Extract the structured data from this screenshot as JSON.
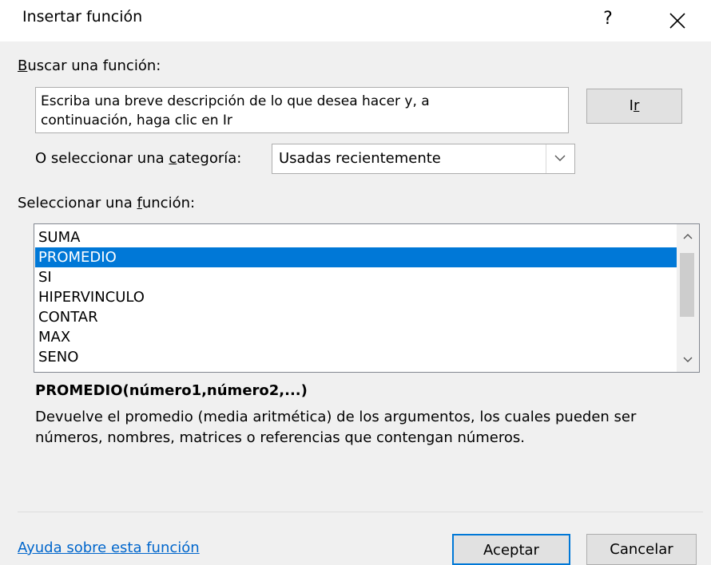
{
  "dialog": {
    "title": "Insertar función",
    "help_glyph": "?"
  },
  "search": {
    "label": "Buscar una función:",
    "label_prefix": "B",
    "label_rest": "uscar una función:",
    "value": "Escriba una breve descripción de lo que desea hacer y, a\ncontinuación, haga clic en Ir",
    "go_label_prefix": "I",
    "go_label_accel": "r",
    "go_label": "Ir"
  },
  "category": {
    "label_prefix": "O seleccionar una ",
    "label_accel": "c",
    "label_rest": "ategoría:",
    "selected": "Usadas recientemente"
  },
  "functions": {
    "label_prefix": "Seleccionar una ",
    "label_accel": "f",
    "label_rest": "unción:",
    "items": [
      "SUMA",
      "PROMEDIO",
      "SI",
      "HIPERVINCULO",
      "CONTAR",
      "MAX",
      "SENO"
    ],
    "selected_index": 1
  },
  "details": {
    "signature": "PROMEDIO(número1,número2,...)",
    "description": "Devuelve el promedio (media aritmética) de los argumentos, los cuales pueden ser números, nombres, matrices o referencias que contengan números."
  },
  "footer": {
    "help_link": "Ayuda sobre esta función",
    "ok_label": "Aceptar",
    "cancel_label": "Cancelar"
  },
  "colors": {
    "selection": "#0078d7",
    "link": "#0066cc",
    "background": "#f0f0f0"
  },
  "icons": {
    "close": "close-icon",
    "dropdown": "chevron-down-icon",
    "scroll_up": "chevron-up-icon",
    "scroll_down": "chevron-down-icon"
  }
}
